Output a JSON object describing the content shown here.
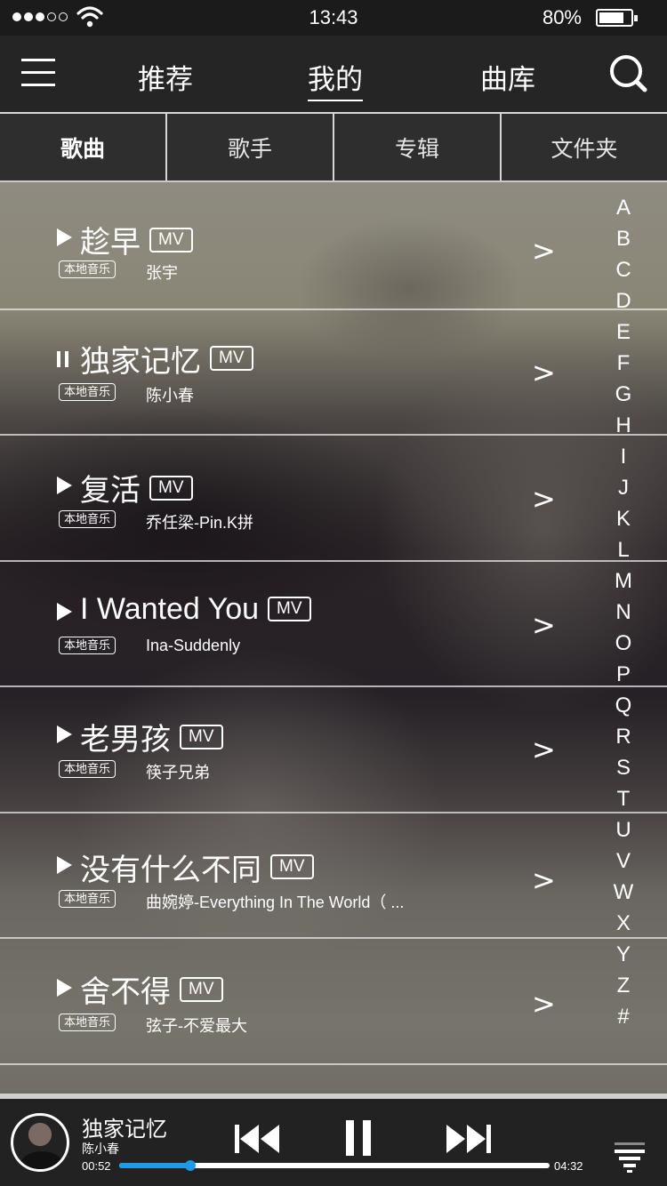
{
  "status_bar": {
    "time": "13:43",
    "battery_percent": "80%",
    "battery_level": 0.8
  },
  "nav": {
    "tabs": [
      {
        "label": "推荐",
        "active": false
      },
      {
        "label": "我的",
        "active": true
      },
      {
        "label": "曲库",
        "active": false
      }
    ]
  },
  "subtabs": [
    {
      "label": "歌曲",
      "active": true
    },
    {
      "label": "歌手",
      "active": false
    },
    {
      "label": "专辑",
      "active": false
    },
    {
      "label": "文件夹",
      "active": false
    }
  ],
  "songs": [
    {
      "title": "趁早",
      "mv": "MV",
      "tag": "本地音乐",
      "artist": "张宇",
      "state": "play"
    },
    {
      "title": "独家记忆",
      "mv": "MV",
      "tag": "本地音乐",
      "artist": "陈小春",
      "state": "pause"
    },
    {
      "title": "复活",
      "mv": "MV",
      "tag": "本地音乐",
      "artist": "乔任梁-Pin.K拼",
      "state": "play"
    },
    {
      "title": "I Wanted You",
      "mv": "MV",
      "tag": "本地音乐",
      "artist": "Ina-Suddenly",
      "state": "play"
    },
    {
      "title": "老男孩",
      "mv": "MV",
      "tag": "本地音乐",
      "artist": "筷子兄弟",
      "state": "play"
    },
    {
      "title": "没有什么不同",
      "mv": "MV",
      "tag": "本地音乐",
      "artist": "曲婉婷-Everything In The World（ ...",
      "state": "play"
    },
    {
      "title": "舍不得",
      "mv": "MV",
      "tag": "本地音乐",
      "artist": "弦子-不爱最大",
      "state": "play"
    }
  ],
  "chevron": ">",
  "alphabet": [
    "A",
    "B",
    "C",
    "D",
    "E",
    "F",
    "G",
    "H",
    "I",
    "J",
    "K",
    "L",
    "M",
    "N",
    "O",
    "P",
    "Q",
    "R",
    "S",
    "T",
    "U",
    "V",
    "W",
    "X",
    "Y",
    "Z",
    "#"
  ],
  "now_playing": {
    "title": "独家记忆",
    "artist": "陈小春",
    "elapsed": "00:52",
    "duration": "04:32",
    "progress": 0.165
  },
  "colors": {
    "accent": "#1e9be8",
    "topbar": "#252525",
    "subtabs": "#2e2e2e",
    "player": "#222222"
  }
}
